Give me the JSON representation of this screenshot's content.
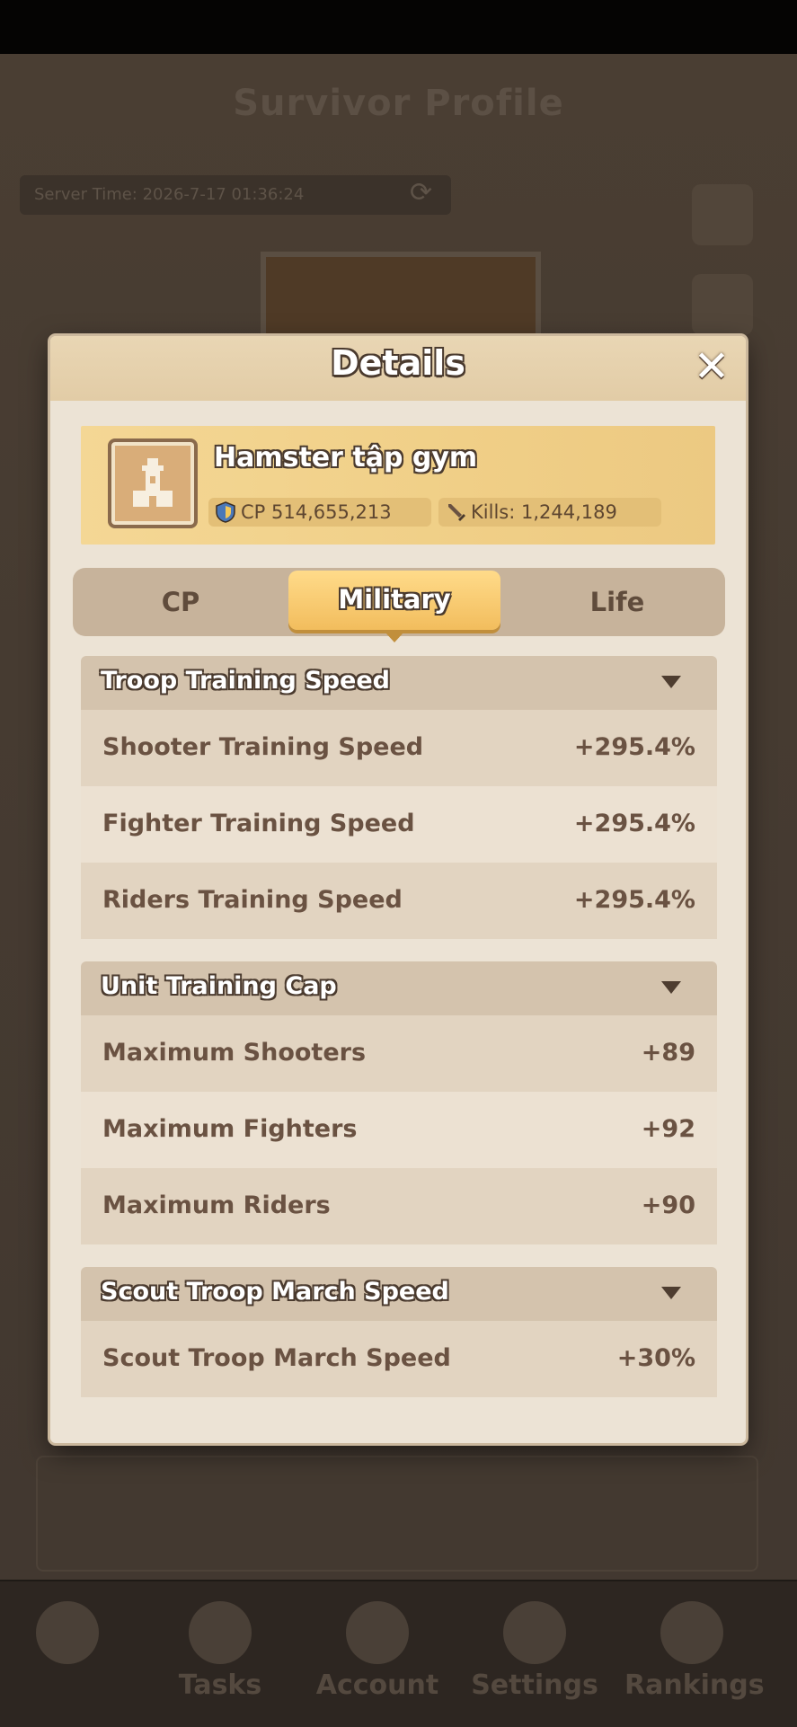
{
  "background": {
    "title": "Survivor Profile",
    "server_time": "Server Time: 2026-7-17 01:36:24",
    "nav": [
      "Tasks",
      "Account",
      "Settings",
      "Rankings"
    ]
  },
  "dialog": {
    "title": "Details",
    "close_icon": "close-icon",
    "player": {
      "name": "Hamster tập gym",
      "cp_label": "CP 514,655,213",
      "kills_label": "Kills:  1,244,189"
    },
    "tabs": [
      {
        "label": "CP",
        "active": false
      },
      {
        "label": "Military",
        "active": true
      },
      {
        "label": "Life",
        "active": false
      }
    ],
    "sections": [
      {
        "title": "Troop Training Speed",
        "rows": [
          {
            "label": "Shooter Training Speed",
            "value": "+295.4%"
          },
          {
            "label": "Fighter Training Speed",
            "value": "+295.4%"
          },
          {
            "label": "Riders Training Speed",
            "value": "+295.4%"
          }
        ]
      },
      {
        "title": "Unit Training Cap",
        "rows": [
          {
            "label": "Maximum Shooters",
            "value": "+89"
          },
          {
            "label": "Maximum Fighters",
            "value": "+92"
          },
          {
            "label": "Maximum Riders",
            "value": "+90"
          }
        ]
      },
      {
        "title": "Scout Troop March Speed",
        "rows": [
          {
            "label": "Scout Troop March Speed",
            "value": "+30%"
          }
        ]
      }
    ]
  },
  "colors": {
    "accent_gold": "#f2bd5d",
    "outline_brown": "#4a3a2e",
    "text_brown": "#6a5242"
  }
}
